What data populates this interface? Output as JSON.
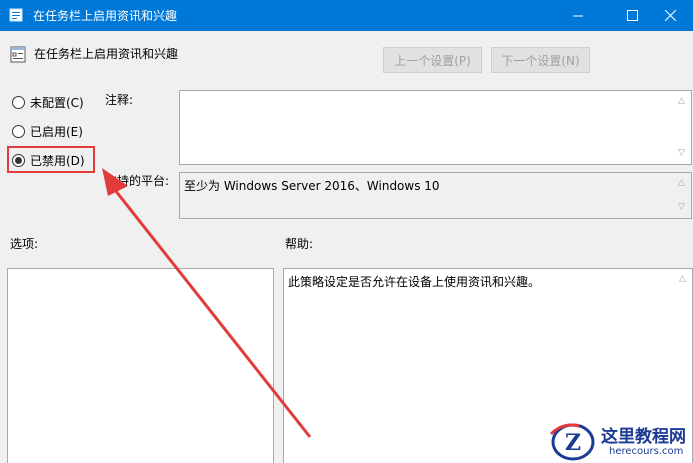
{
  "window": {
    "title": "在任务栏上启用资讯和兴趣"
  },
  "header": {
    "policy_title": "在任务栏上启用资讯和兴趣",
    "prev_setting": "上一个设置(P)",
    "next_setting": "下一个设置(N)"
  },
  "options": {
    "not_configured": "未配置(C)",
    "enabled": "已启用(E)",
    "disabled": "已禁用(D)",
    "selected": "disabled"
  },
  "labels": {
    "comment": "注释:",
    "supported_on": "支持的平台:",
    "options": "选项:",
    "help": "帮助:"
  },
  "fields": {
    "comment_value": "",
    "supported_value": "至少为 Windows Server 2016、Windows 10",
    "help_text": "此策略设定是否允许在设备上使用资讯和兴趣。"
  },
  "watermark": {
    "site_name": "这里教程网",
    "url": "herecours.com",
    "logo_letter": "Z"
  },
  "colors": {
    "titlebar": "#0078d7",
    "annotation": "#e23b3b",
    "watermark": "#1b3a93"
  },
  "icons": {
    "app": "policy-icon",
    "minimize": "minimize-icon",
    "maximize": "maximize-icon",
    "close": "close-icon"
  }
}
